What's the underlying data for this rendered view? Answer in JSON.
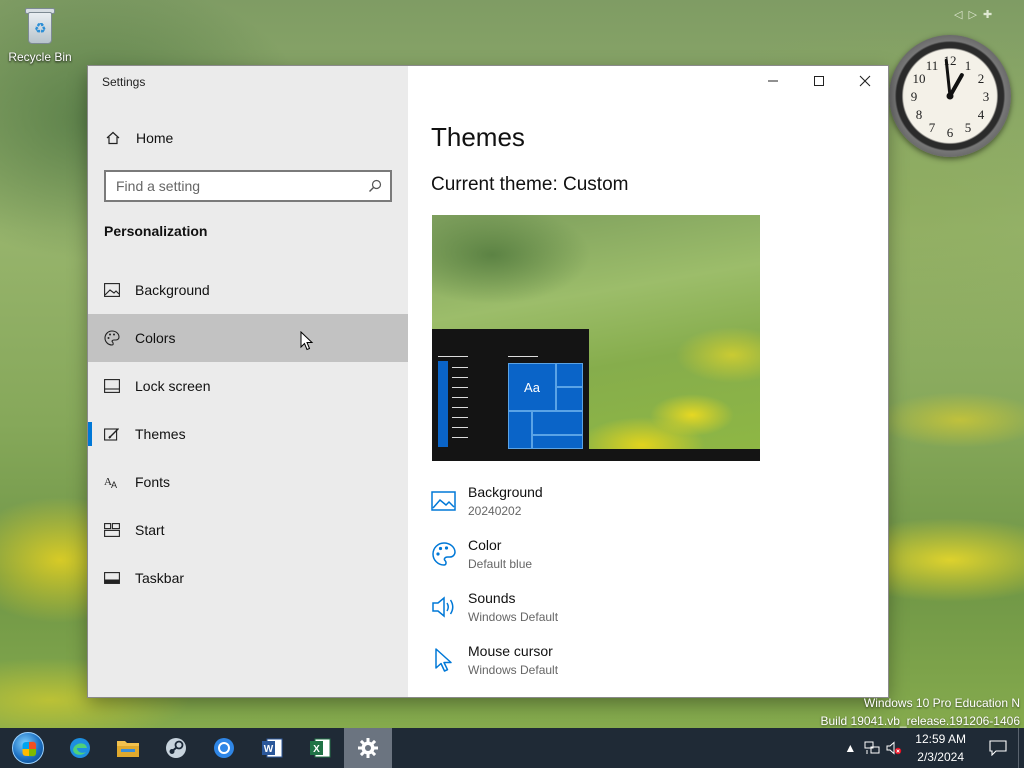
{
  "desktop": {
    "recycle_bin_label": "Recycle Bin"
  },
  "clock": {
    "time_hour": 12,
    "time_minute": 59
  },
  "window": {
    "title": "Settings",
    "home_label": "Home",
    "search_placeholder": "Find a setting",
    "section_title": "Personalization",
    "nav_items": [
      {
        "label": "Background",
        "icon": "image-icon"
      },
      {
        "label": "Colors",
        "icon": "palette-icon"
      },
      {
        "label": "Lock screen",
        "icon": "lock-screen-icon"
      },
      {
        "label": "Themes",
        "icon": "brush-icon"
      },
      {
        "label": "Fonts",
        "icon": "fonts-icon"
      },
      {
        "label": "Start",
        "icon": "start-icon"
      },
      {
        "label": "Taskbar",
        "icon": "taskbar-icon"
      }
    ],
    "selected_nav": "Themes",
    "hovered_nav": "Colors"
  },
  "content": {
    "heading": "Themes",
    "current_theme": "Current theme: Custom",
    "preview_tile_label": "Aa",
    "options": [
      {
        "title": "Background",
        "value": "20240202",
        "icon": "image-icon"
      },
      {
        "title": "Color",
        "value": "Default blue",
        "icon": "palette-icon"
      },
      {
        "title": "Sounds",
        "value": "Windows Default",
        "icon": "speaker-icon"
      },
      {
        "title": "Mouse cursor",
        "value": "Windows Default",
        "icon": "cursor-icon"
      }
    ]
  },
  "watermark": {
    "line1": "Windows 10 Pro Education N",
    "line2": "Build 19041.vb_release.191206-1406"
  },
  "taskbar": {
    "time": "12:59 AM",
    "date": "2/3/2024"
  },
  "colors": {
    "accent": "#0078d7",
    "taskbar": "#1f2a36"
  }
}
